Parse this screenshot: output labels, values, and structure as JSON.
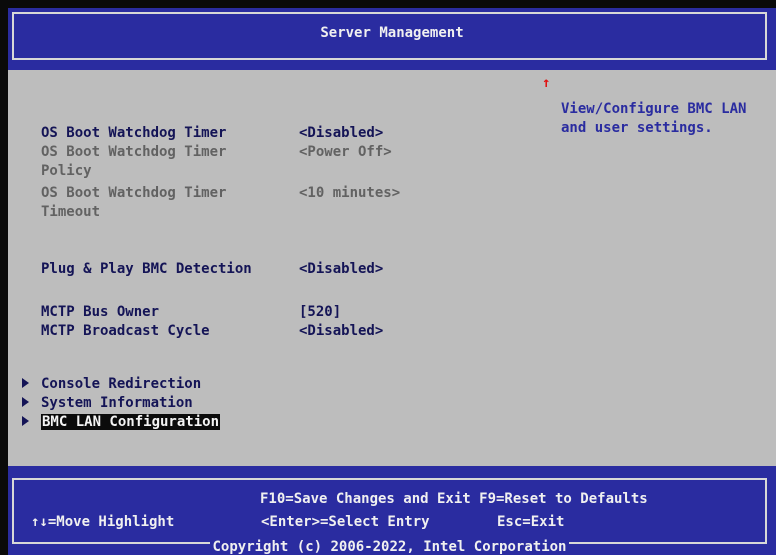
{
  "header": {
    "title": "Server Management"
  },
  "settings": [
    {
      "label": "OS Boot Watchdog Timer",
      "value": "<Disabled>",
      "state": "active"
    },
    {
      "label": "OS Boot Watchdog Timer Policy",
      "value": "<Power Off>",
      "state": "disabled"
    },
    {
      "label": "OS Boot Watchdog Timer Timeout",
      "value": "<10 minutes>",
      "state": "disabled"
    },
    {
      "label": "Plug & Play BMC Detection",
      "value": "<Disabled>",
      "state": "active"
    },
    {
      "label": "MCTP Bus Owner",
      "value": "[520]",
      "state": "active"
    },
    {
      "label": "MCTP Broadcast Cycle",
      "value": "<Disabled>",
      "state": "active"
    }
  ],
  "submenus": [
    {
      "label": "Console Redirection",
      "selected": false
    },
    {
      "label": "System Information",
      "selected": false
    },
    {
      "label": "BMC LAN Configuration",
      "selected": true
    }
  ],
  "help": {
    "text": "View/Configure BMC LAN and user settings."
  },
  "footer": {
    "line1": "F10=Save Changes and Exit F9=Reset to Defaults",
    "nav_hint": "↑↓=Move Highlight",
    "enter_hint": "<Enter>=Select Entry",
    "esc_hint": "Esc=Exit",
    "copyright": "Copyright (c) 2006-2022, Intel Corporation"
  },
  "colors": {
    "frame_blue": "#2a2ca0",
    "panel_gray": "#bdbdbd",
    "active_text": "#141456",
    "disabled_text": "#626262",
    "scroll_arrow": "#e01010"
  }
}
